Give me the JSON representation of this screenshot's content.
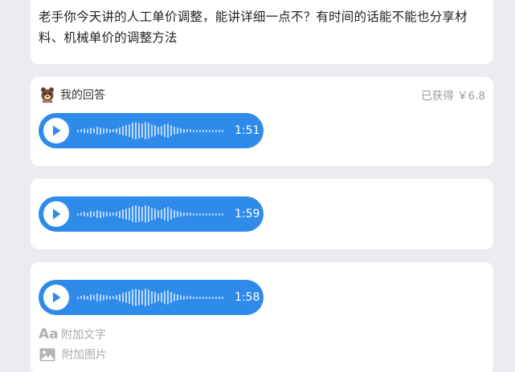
{
  "question": {
    "text": "老手你今天讲的人工单价调整，能讲详细一点不？有时间的话能不能也分享材料、机械单价的调整方法"
  },
  "answers": {
    "label": "我的回答",
    "earned": "已获得 ￥6.8",
    "voices": [
      {
        "duration": "1:51"
      },
      {
        "duration": "1:59"
      },
      {
        "duration": "1:58"
      }
    ]
  },
  "attachments": {
    "text_label": "附加文字",
    "image_label": "附加图片",
    "text_icon": "Aa"
  },
  "colors": {
    "background": "#ebebf0",
    "voice_bubble": "#2f8bea",
    "muted_text": "#999999"
  }
}
